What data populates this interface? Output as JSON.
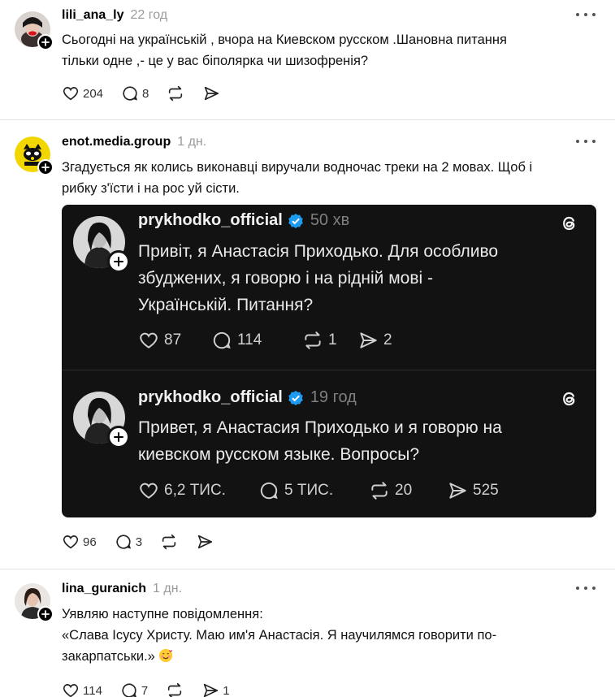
{
  "posts": [
    {
      "username": "lili_ana_ly",
      "time": "22 год",
      "text_lines": [
        "Сьогодні на українській , вчора на Киевском русском .Шановна питання",
        "тільки одне ,- це у вас біполярка чи шизофренія?"
      ],
      "likes": "204",
      "comments": "8"
    },
    {
      "username": "enot.media.group",
      "time": "1 дн.",
      "text_lines": [
        "Згадується як колись виконавці виручали водночас треки на 2 мовах. Щоб і",
        "рибку з'їсти і на рос уй сісти."
      ],
      "likes": "96",
      "comments": "3",
      "embed": {
        "items": [
          {
            "username": "prykhodko_official",
            "time": "50 хв",
            "text_lines": [
              "Привіт, я Анастасія Приходько. Для особливо",
              "збуджених, я говорю і на рідній мові -",
              "Українській. Питання?"
            ],
            "likes": "87",
            "comments": "114",
            "reposts": "1",
            "shares": "2"
          },
          {
            "username": "prykhodko_official",
            "time": "19 год",
            "text_lines": [
              "Привет, я Анастасия Приходько и я говорю на",
              "киевском русском языке. Вопросы?"
            ],
            "likes": "6,2 ТИС.",
            "comments": "5 ТИС.",
            "reposts": "20",
            "shares": "525"
          }
        ]
      }
    },
    {
      "username": "lina_guranich",
      "time": "1 дн.",
      "text_lines": [
        "Уявляю наступне повідомлення:",
        "«Слава Ісусу Христу. Маю им'я Анастасія. Я научилямся говорити по-",
        "закарпатськи.»"
      ],
      "likes": "114",
      "comments": "7",
      "reposts": "",
      "shares": "1"
    }
  ],
  "icons": {
    "like": "heart-icon",
    "comment": "comment-icon",
    "repost": "repost-icon",
    "share": "share-icon",
    "more": "more-icon",
    "follow": "plus-icon",
    "verified": "verified-badge-icon",
    "threads": "threads-logo-icon",
    "emoji": "smiling-face-with-hearts-emoji"
  },
  "colors": {
    "background": "#ffffff",
    "muted": "#9a9a9a",
    "embed_bg": "#121212",
    "verified": "#1d9bf0"
  }
}
